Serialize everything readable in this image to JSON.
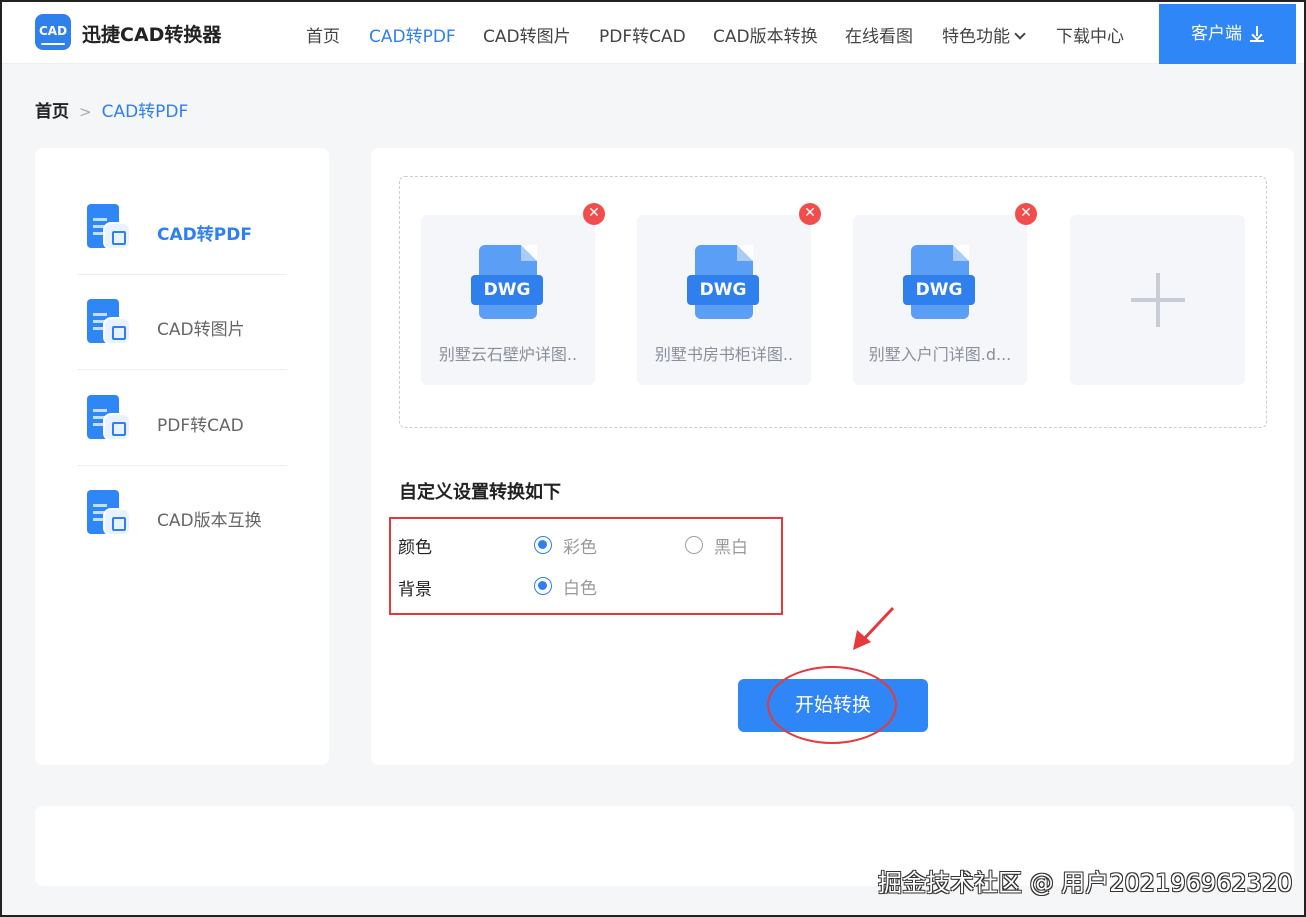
{
  "app": {
    "logo_text": "迅捷CAD转换器",
    "logo_icon_text": "CAD"
  },
  "nav": {
    "items": [
      {
        "label": "首页"
      },
      {
        "label": "CAD转PDF",
        "active": true
      },
      {
        "label": "CAD转图片"
      },
      {
        "label": "PDF转CAD"
      },
      {
        "label": "CAD版本转换"
      },
      {
        "label": "在线看图"
      },
      {
        "label": "特色功能"
      },
      {
        "label": "下载中心"
      }
    ],
    "client_button": "客户端"
  },
  "breadcrumb": {
    "home": "首页",
    "separator": ">",
    "current": "CAD转PDF"
  },
  "sidebar": {
    "items": [
      {
        "label": "CAD转PDF",
        "icon": "cad-to-pdf-icon",
        "active": true
      },
      {
        "label": "CAD转图片",
        "icon": "cad-to-image-icon"
      },
      {
        "label": "PDF转CAD",
        "icon": "pdf-to-cad-icon"
      },
      {
        "label": "CAD版本互换",
        "icon": "cad-version-icon"
      }
    ]
  },
  "files": [
    {
      "badge": "DWG",
      "name": "别墅云石壁炉详图.."
    },
    {
      "badge": "DWG",
      "name": "别墅书房书柜详图.."
    },
    {
      "badge": "DWG",
      "name": "别墅入户门详图.d..."
    }
  ],
  "settings": {
    "title": "自定义设置转换如下",
    "color_label": "颜色",
    "color_options": [
      {
        "label": "彩色",
        "checked": true
      },
      {
        "label": "黑白",
        "checked": false
      }
    ],
    "background_label": "背景",
    "background_options": [
      {
        "label": "白色",
        "checked": true
      }
    ]
  },
  "actions": {
    "start": "开始转换"
  },
  "watermark": "掘金技术社区 @ 用户202196962320",
  "colors": {
    "accent": "#2f80ed",
    "button": "#2f86f6",
    "annotation_red": "#e5393b",
    "remove_red": "#f24d4d"
  }
}
